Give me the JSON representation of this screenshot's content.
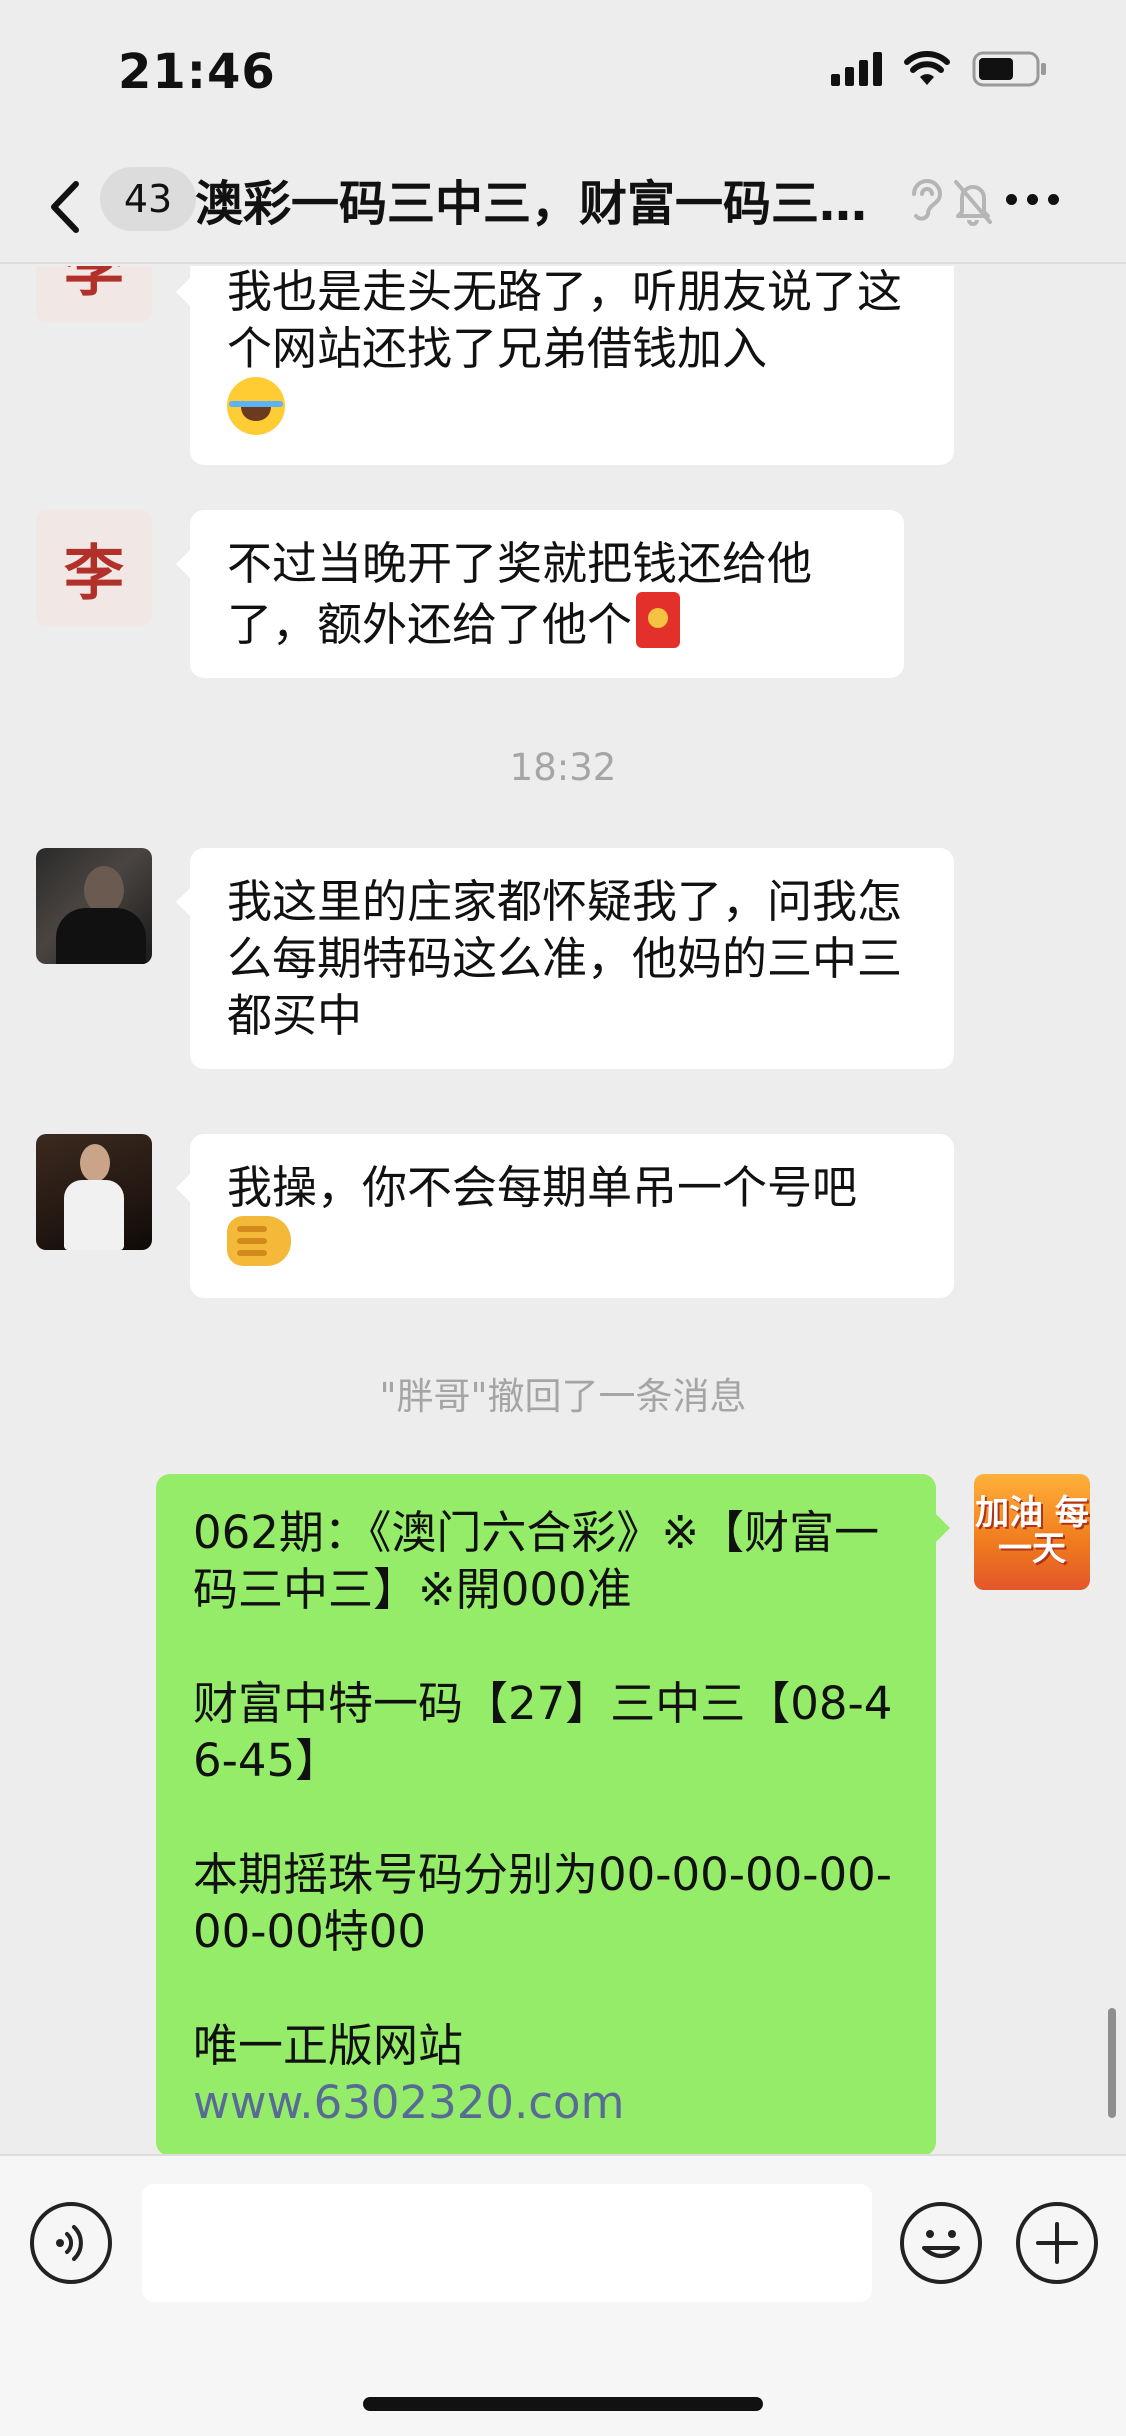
{
  "status_bar": {
    "time": "21:46",
    "icons": [
      "cellular-signal-icon",
      "wifi-icon",
      "battery-icon"
    ]
  },
  "nav": {
    "back_icon": "chevron-left-icon",
    "unread_count": "43",
    "title": "澳彩一码三中三，财富一码三…",
    "icons": [
      "ear-icon",
      "bell-muted-icon",
      "more-icon"
    ]
  },
  "messages": [
    {
      "sender_avatar": "李",
      "text": "我也是走头无路了，听朋友说了这个网站还找了兄弟借钱加入",
      "emoji": "laughing-tears-emoji"
    },
    {
      "sender_avatar": "李",
      "text": "不过当晚开了奖就把钱还给他了，额外还给了他个",
      "emoji": "red-packet-emoji"
    },
    {
      "sender_avatar": "photo-man-dark",
      "text": "我这里的庄家都怀疑我了，问我怎么每期特码这么准，他妈的三中三都买中"
    },
    {
      "sender_avatar": "photo-man-white-shirt",
      "text": "我操，你不会每期单吊一个号吧",
      "emoji": "fist-emoji"
    }
  ],
  "timestamp": "18:32",
  "recall_notice": "\"胖哥\"撤回了一条消息",
  "self_message": {
    "avatar_text": "加油 每一天",
    "paragraphs": [
      "062期：《澳门六合彩》※【财富一码三中三】※開000准",
      "财富中特一码【27】三中三【08-46-45】",
      "本期摇珠号码分别为00-00-00-00-00-00特00",
      "唯一正版网站"
    ],
    "link": "www.6302320.com"
  },
  "input_bar": {
    "voice_icon": "voice-icon",
    "emoji_icon": "smiley-icon",
    "plus_icon": "plus-icon",
    "placeholder": ""
  },
  "colors": {
    "background": "#ededed",
    "bubble_other": "#ffffff",
    "bubble_self": "#95ec69",
    "link": "#576b95",
    "system_text": "#a5a5a5"
  }
}
